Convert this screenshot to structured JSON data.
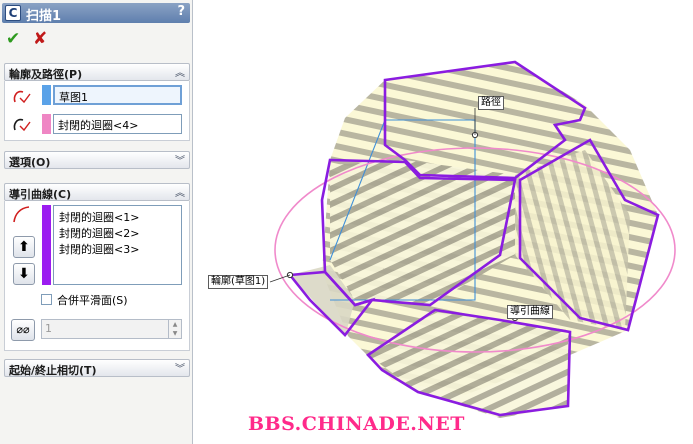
{
  "panel": {
    "title": "扫描1",
    "help_label": "?",
    "ok_label": "✔",
    "cancel_label": "✘",
    "profile_path": {
      "header": "輪廓及路徑(P)",
      "profile_value": "草图1",
      "path_value": "封閉的迴圈<4>",
      "profile_color": "#5aa2e8",
      "path_color": "#ef86c4"
    },
    "options": {
      "header": "選項(O)"
    },
    "guide_curves": {
      "header": "導引曲線(C)",
      "color": "#9b1cf0",
      "items": [
        "封閉的迴圈<1>",
        "封閉的迴圈<2>",
        "封閉的迴圈<3>"
      ],
      "merge_label": "合併平滑面(S)",
      "spin_value": "1"
    },
    "start_end": {
      "header": "起始/終止相切(T)"
    }
  },
  "viewport": {
    "label_path": "路徑",
    "label_profile": "輪廓(草图1)",
    "label_guide": "導引曲線",
    "watermark": "BBS.CHINADE.NET",
    "edge_color": "#8a1ce0",
    "ellipse_color": "#f08acb"
  }
}
